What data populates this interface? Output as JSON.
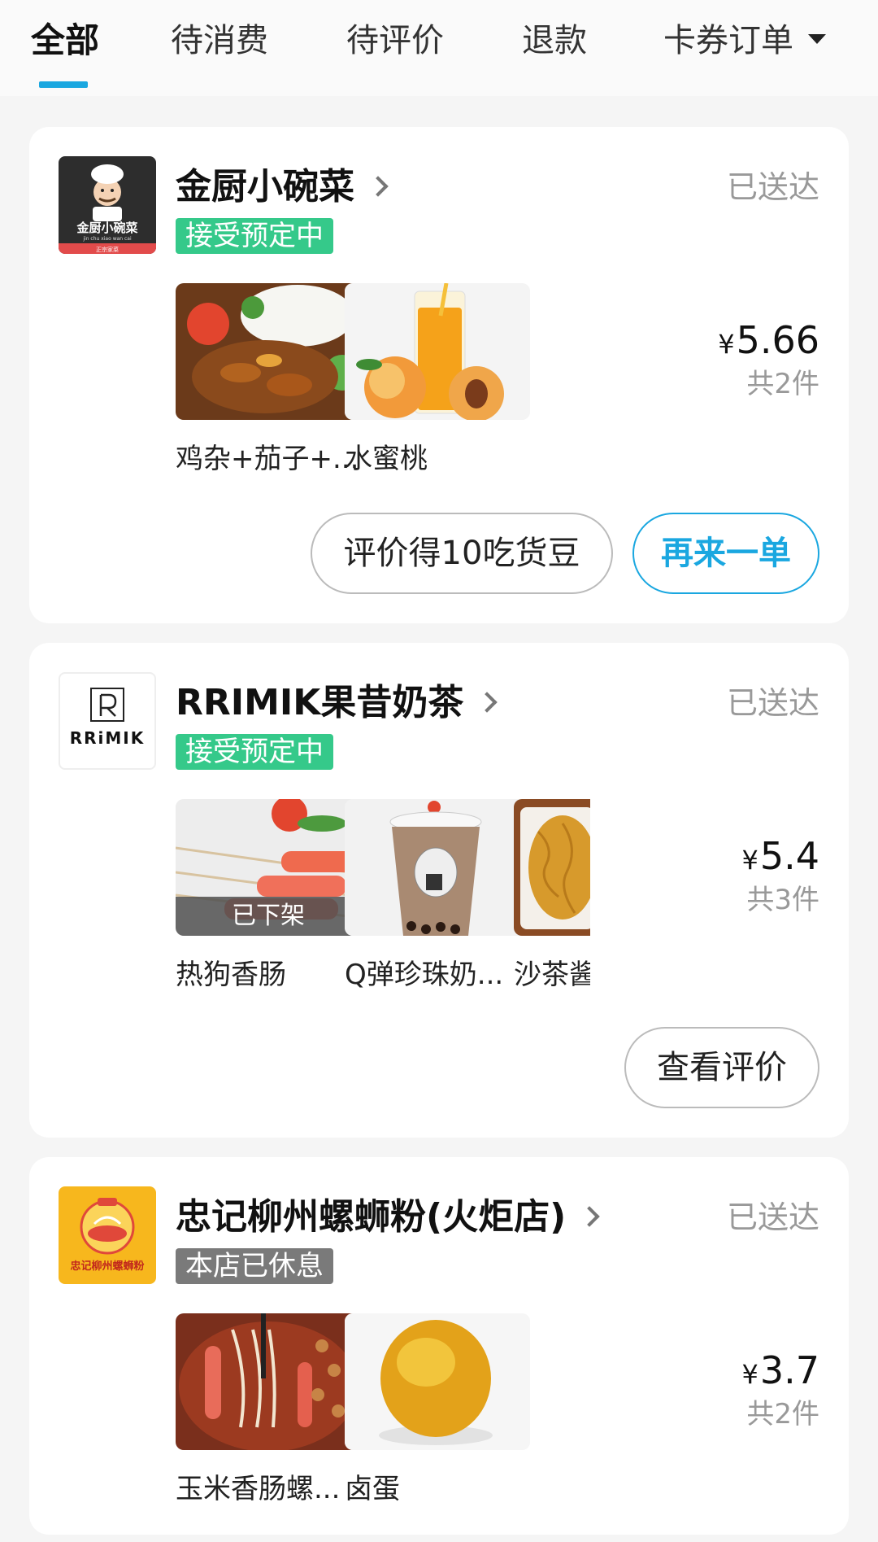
{
  "tabs": [
    {
      "label": "全部"
    },
    {
      "label": "待消费"
    },
    {
      "label": "待评价"
    },
    {
      "label": "退款"
    },
    {
      "label": "卡券订单"
    }
  ],
  "orders": [
    {
      "shop_name": "金厨小碗菜",
      "status": "已送达",
      "badge": "接受预定中",
      "logo_text": "金厨小碗菜",
      "logo_subtext": "jin chu xiao wan cai",
      "logo_tag": "正宗家菜",
      "items": [
        {
          "name": "鸡杂+茄子+...",
          "icon": "chicken-rice-dish-image"
        },
        {
          "name": "水蜜桃",
          "icon": "peach-juice-image"
        }
      ],
      "price_symbol": "¥",
      "price": "5.66",
      "count": "共2件",
      "buttons": {
        "review": "评价得10吃货豆",
        "reorder": "再来一单"
      }
    },
    {
      "shop_name": "RRIMIK果昔奶茶",
      "status": "已送达",
      "badge": "接受预定中",
      "logo_text": "RRiMIK",
      "items": [
        {
          "name": "热狗香肠",
          "icon": "hot-dog-sausage-image",
          "overlay": "已下架"
        },
        {
          "name": "Q弹珍珠奶...",
          "icon": "bubble-milk-tea-image"
        },
        {
          "name": "沙茶酱",
          "icon": "noodles-image"
        }
      ],
      "price_symbol": "¥",
      "price": "5.4",
      "count": "共3件",
      "buttons": {
        "view_review": "查看评价"
      }
    },
    {
      "shop_name": "忠记柳州螺蛳粉(火炬店)",
      "status": "已送达",
      "badge": "本店已休息",
      "logo_text": "忠记柳州螺蛳粉",
      "items": [
        {
          "name": "玉米香肠螺...",
          "icon": "snail-noodle-image"
        },
        {
          "name": "卤蛋",
          "icon": "braised-egg-image"
        }
      ],
      "price_symbol": "¥",
      "price": "3.7",
      "count": "共2件"
    }
  ],
  "colors": {
    "accent": "#1aa7e0",
    "badge_green": "#35c98a",
    "badge_gray": "#7a7a7a",
    "muted_text": "#999999",
    "background": "#f5f5f5"
  }
}
